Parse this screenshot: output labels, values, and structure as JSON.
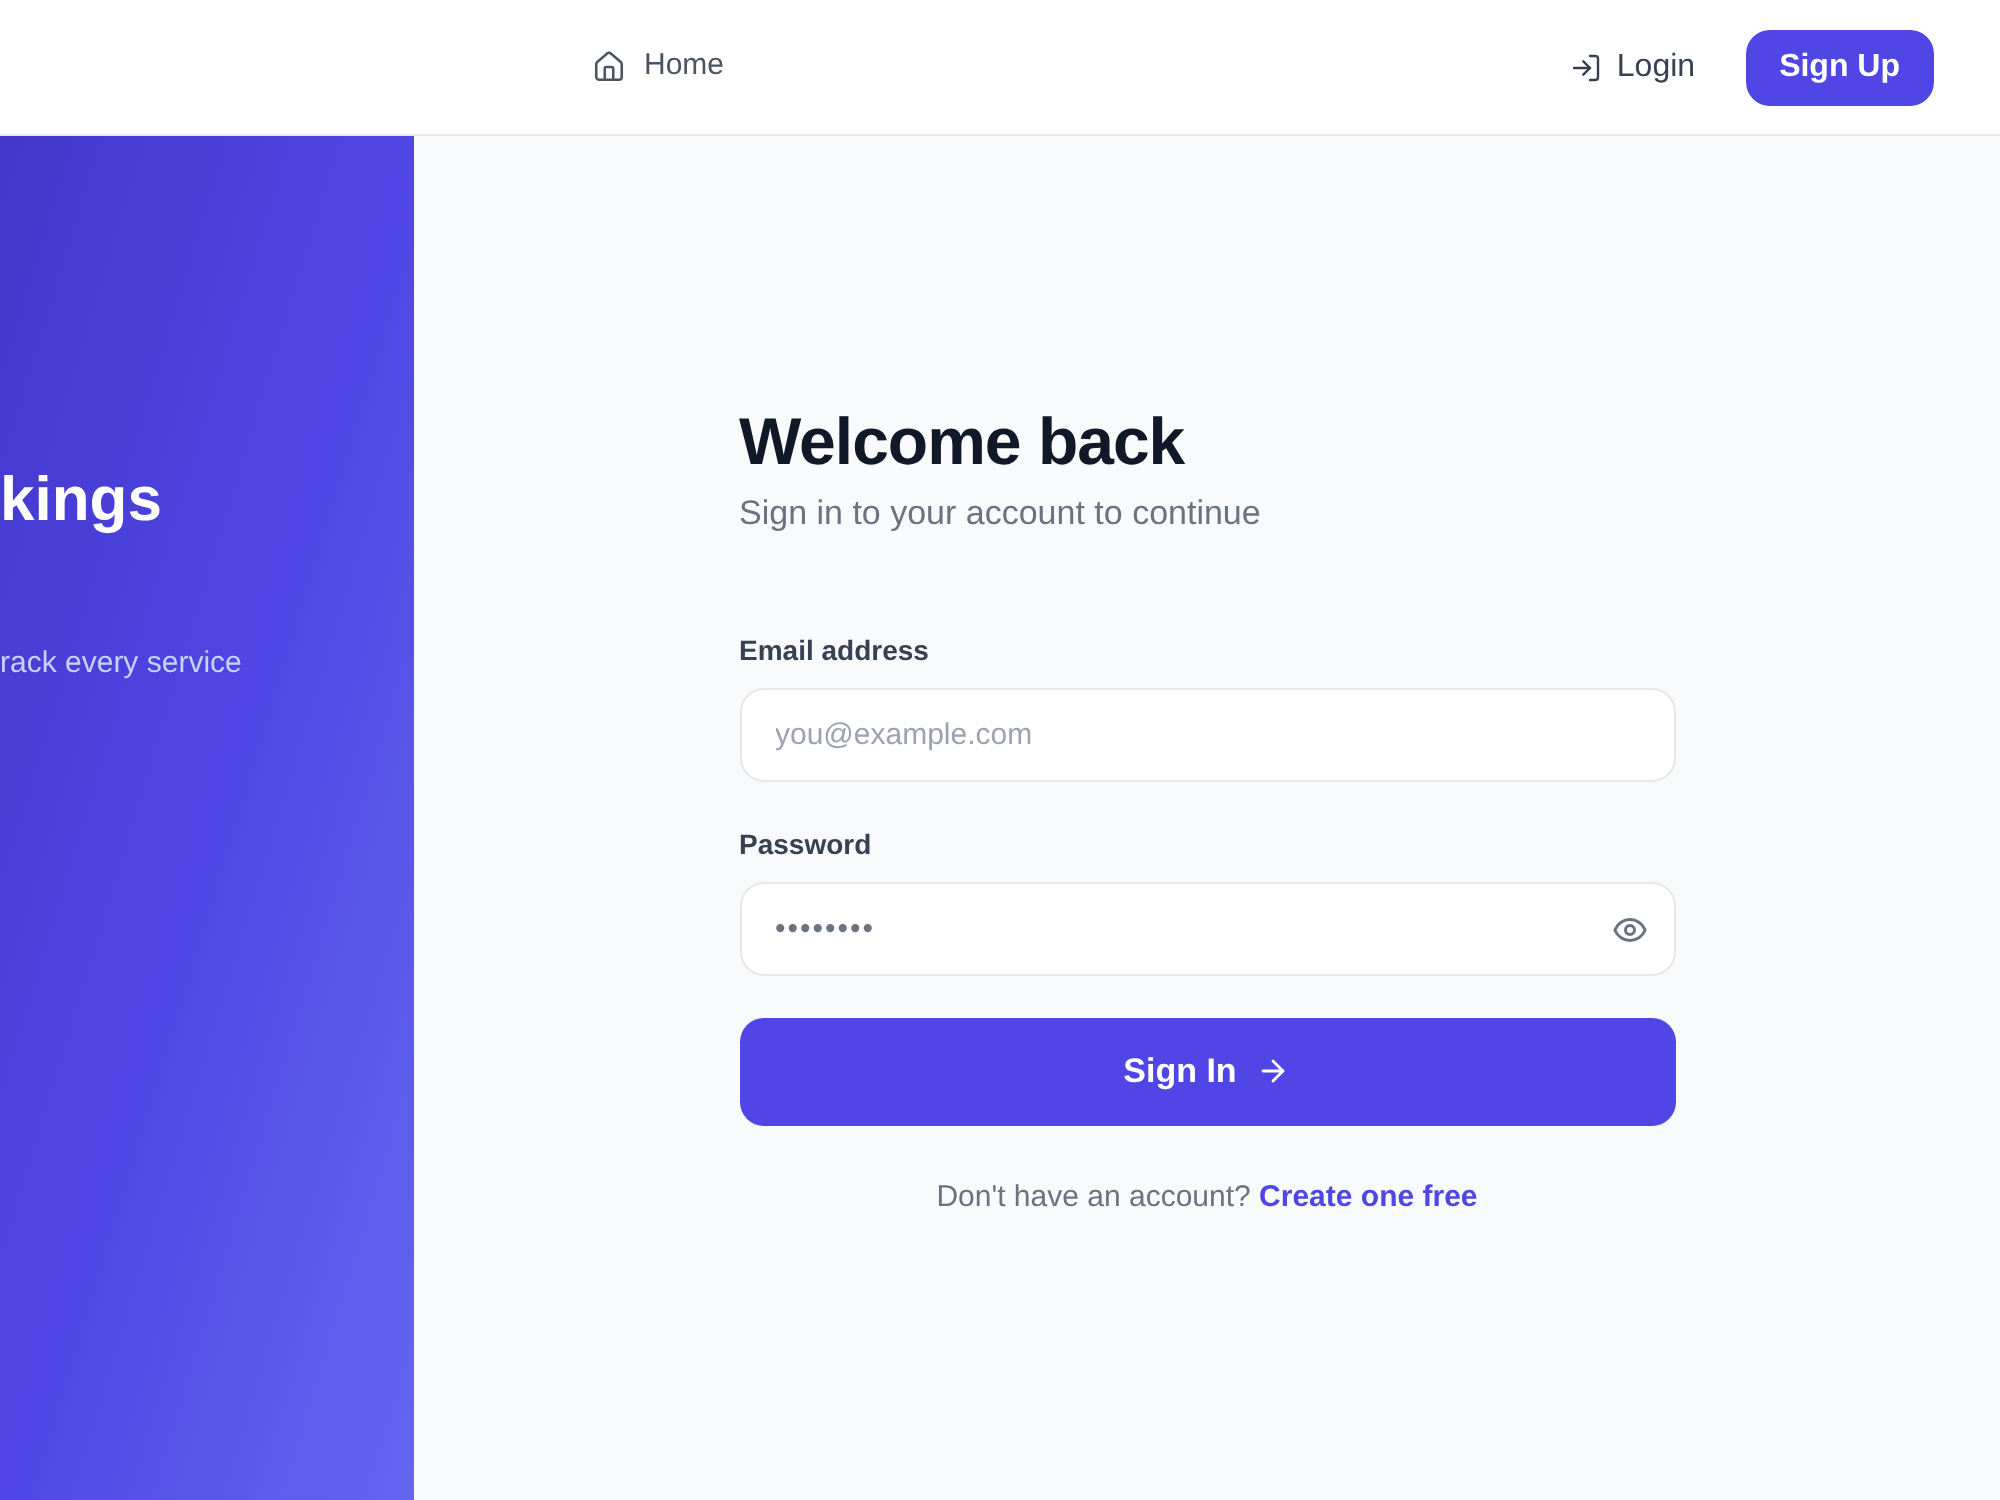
{
  "header": {
    "nav": [
      {
        "label": "Home"
      }
    ],
    "login": "Login",
    "signup": "Sign Up"
  },
  "hero": {
    "heading": "kings",
    "text": "rack every service"
  },
  "form": {
    "title": "Welcome back",
    "subtitle": "Sign in to your account to continue",
    "fields": [
      {
        "kind": "email",
        "label": "Email address",
        "placeholder": "you@example.com"
      },
      {
        "kind": "password",
        "label": "Password",
        "value": "••••••••"
      }
    ],
    "submit": "Sign In",
    "footer": {
      "text": "Don't have an account?",
      "link": "Create one free"
    }
  }
}
